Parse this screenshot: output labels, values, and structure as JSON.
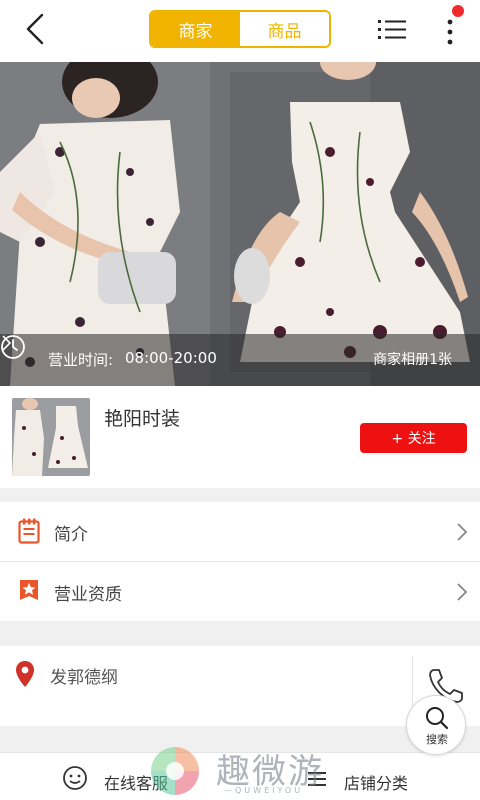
{
  "header": {
    "tabs": [
      {
        "label": "商家",
        "active": true
      },
      {
        "label": "商品",
        "active": false
      }
    ],
    "back_icon": "chevron-left-icon",
    "list_icon": "list-icon",
    "more_icon": "more-vertical-icon",
    "notification_dot_color": "#ee2a2a"
  },
  "banner": {
    "hours_label": "营业时间:",
    "hours_value": "08:00-20:00",
    "album_link": "商家相册1张"
  },
  "shop": {
    "name": "艳阳时装",
    "follow_label": "+ 关注"
  },
  "rows": [
    {
      "label": "简介",
      "icon": "notebook-icon"
    },
    {
      "label": "营业资质",
      "icon": "star-badge-icon"
    }
  ],
  "address": {
    "text": "发郭德纲",
    "icon": "location-pin-icon",
    "phone_icon": "phone-icon"
  },
  "search_fab": {
    "label": "搜索"
  },
  "bottom_bar": {
    "customer_service_label": "在线客服",
    "categories_label": "店铺分类"
  },
  "watermark": {
    "text": "趣微游",
    "sub": "—QUWEIYOU"
  },
  "colors": {
    "accent": "#f0b400",
    "follow": "#ee1111",
    "icon_orange": "#e8562a",
    "pin_red": "#d0322a"
  }
}
